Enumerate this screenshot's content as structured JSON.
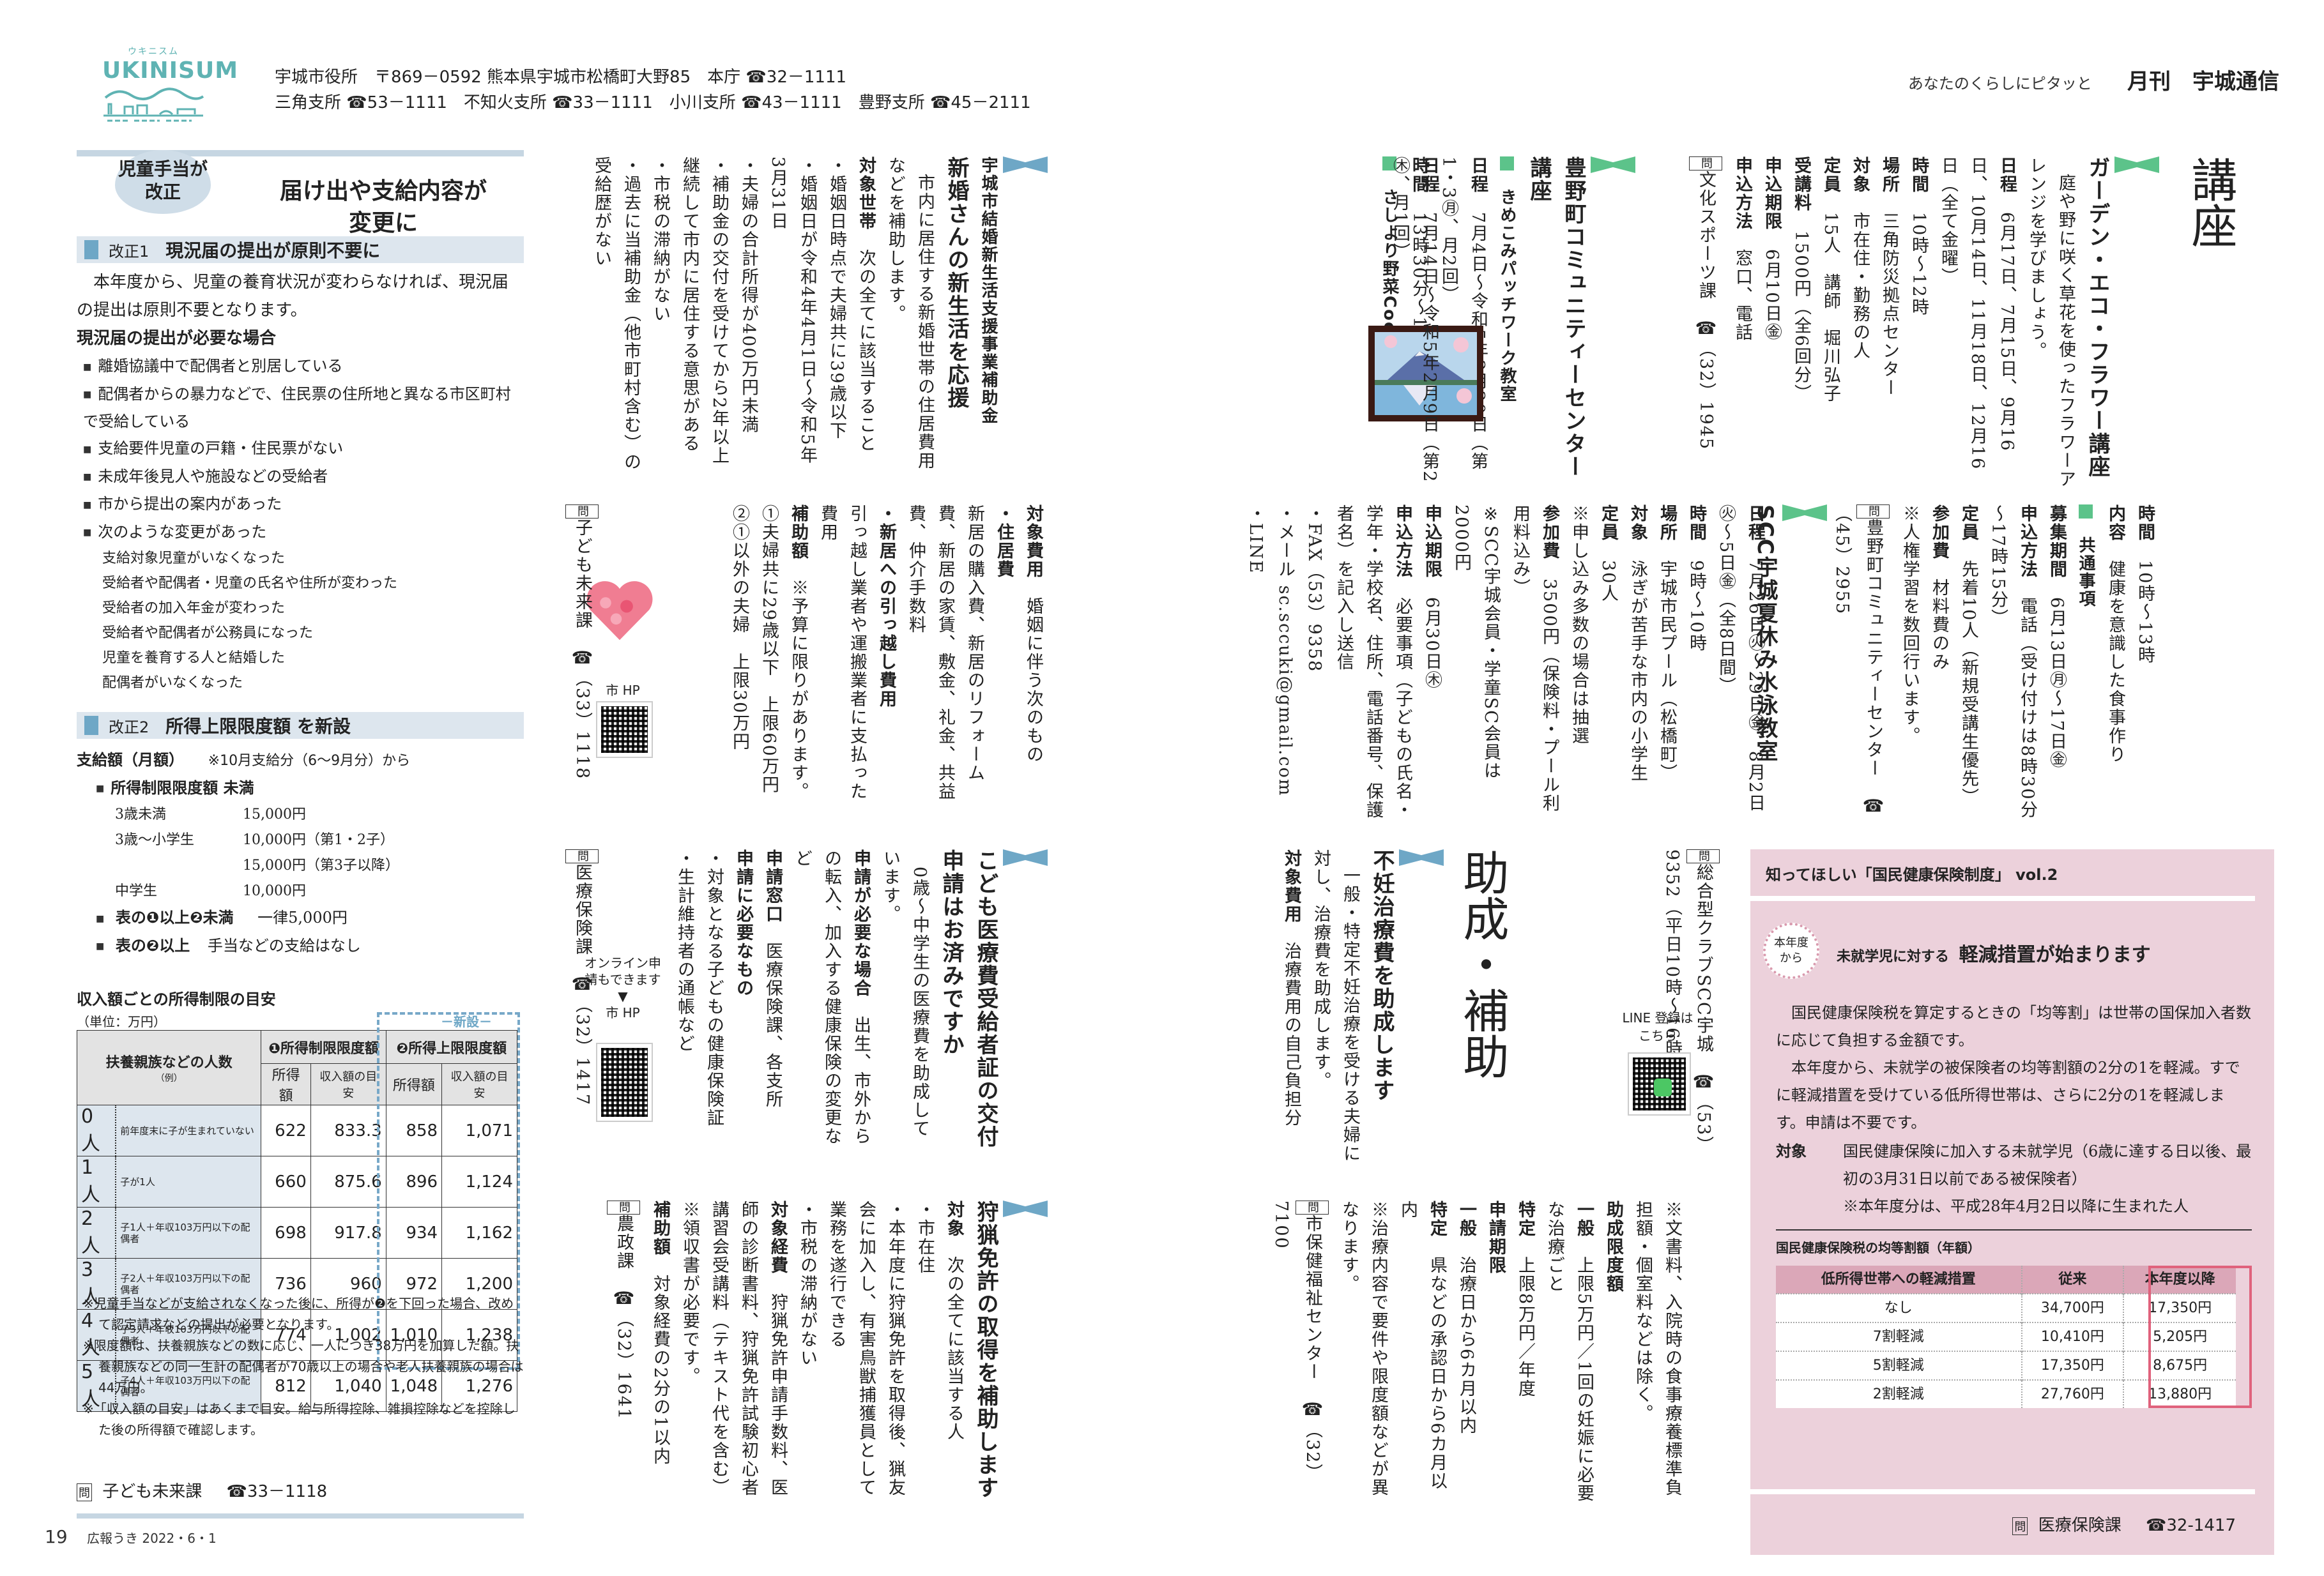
{
  "header": {
    "logo_kana": "ウキニスム",
    "logo_text": "UKINISUM",
    "line1": "宇城市役所　〒869－0592 熊本県宇城市松橋町大野85　本庁 ☎32－1111",
    "line2": "三角支所 ☎53－1111　不知火支所 ☎33－1111　小川支所 ☎43－1111　豊野支所 ☎45－2111",
    "tagline": "あなたのくらしにピタッと",
    "magazine_title": "月刊　宇城通信"
  },
  "child_allowance": {
    "bubble": [
      "児童手当が",
      "改正"
    ],
    "title": [
      "届け出や支給内容が",
      "変更に"
    ],
    "rev1": {
      "num": "改正1",
      "title": "現況届の提出が原則不要に"
    },
    "rev1_body": "本年度から、児童の養育状況が変わらなければ、現況届の提出は原則不要となります。",
    "rev1_required_heading": "現況届の提出が必要な場合",
    "rev1_items": [
      "離婚協議中で配偶者と別居している",
      "配偶者からの暴力などで、住民票の住所地と異なる市区町村で受給している",
      "支給要件児童の戸籍・住民票がない",
      "未成年後見人や施設などの受給者",
      "市から提出の案内があった",
      "次のような変更があった"
    ],
    "rev1_changes": [
      "支給対象児童がいなくなった",
      "受給者や配偶者・児童の氏名や住所が変わった",
      "受給者の加入年金が変わった",
      "受給者や配偶者が公務員になった",
      "児童を養育する人と結婚した",
      "配偶者がいなくなった"
    ],
    "rev2": {
      "num": "改正2",
      "title": "所得上限限度額 を新設"
    },
    "payment_label": "支給額（月額）",
    "payment_note": "※10月支給分（6～9月分）から",
    "under_limit_label": "所得制限限度額 未満",
    "amounts": [
      {
        "age": "3歳未満",
        "amount": "15,000円"
      },
      {
        "age": "3歳～小学生",
        "amount": "10,000円（第1・2子）"
      },
      {
        "age": "",
        "amount": "15,000円（第3子以降）"
      },
      {
        "age": "中学生",
        "amount": "10,000円"
      }
    ],
    "rule_1_to_2": {
      "label": "表の❶以上❷未満",
      "value": "一律5,000円"
    },
    "rule_2_over": {
      "label": "表の❷以上",
      "value": "手当などの支給はなし"
    },
    "table_title": "収入額ごとの所得制限の目安",
    "table_unit": "（単位：万円）",
    "table_new_label": "－新設－",
    "table_headers": {
      "dependents": "扶養親族などの人数",
      "dependents_note": "（例）",
      "limit1": "❶所得制限限度額",
      "limit2": "❷所得上限限度額",
      "income": "所得額",
      "revenue": "収入額の目安"
    },
    "table_rows": [
      {
        "n": "0人",
        "desc": "前年度末に子が生まれていない",
        "i1": "622",
        "r1": "833.3",
        "i2": "858",
        "r2": "1,071"
      },
      {
        "n": "1人",
        "desc": "子が1人",
        "i1": "660",
        "r1": "875.6",
        "i2": "896",
        "r2": "1,124"
      },
      {
        "n": "2人",
        "desc": "子1人＋年収103万円以下の配偶者",
        "i1": "698",
        "r1": "917.8",
        "i2": "934",
        "r2": "1,162"
      },
      {
        "n": "3人",
        "desc": "子2人＋年収103万円以下の配偶者",
        "i1": "736",
        "r1": "960",
        "i2": "972",
        "r2": "1,200"
      },
      {
        "n": "4人",
        "desc": "子3人＋年収103万円以下の配偶者",
        "i1": "774",
        "r1": "1,002",
        "i2": "1,010",
        "r2": "1,238"
      },
      {
        "n": "5人",
        "desc": "子4人＋年収103万円以下の配偶者",
        "i1": "812",
        "r1": "1,040",
        "i2": "1,048",
        "r2": "1,276"
      }
    ],
    "notes": [
      "※児童手当などが支給されなくなった後に、所得が❷を下回った場合、改めて認定請求などの提出が必要となります。",
      "※限度額は、扶養親族などの数に応じ、一人につき38万円を加算した額。扶養親族などの同一生計の配偶者が70歳以上の場合や老人扶養親族の場合は44万円。",
      "※「収入額の目安」はあくまで目安。給与所得控除、雑損控除などを控除した後の所得額で確認します。"
    ],
    "contact": {
      "dept": "子ども未来課",
      "tel": "☎33－1118"
    }
  },
  "newlywed": {
    "kicker": "宇城市結婚新生活支援事業補助金",
    "title": "新婚さんの新生活を応援",
    "lead": "市内に居住する新婚世帯の住居費用などを補助します。",
    "target_label": "対象世帯",
    "target_text": "次の全てに該当すること",
    "items": [
      "婚姻日時点で夫婦共に39歳以下",
      "婚姻日が令和4年4月1日～令和5年3月31日",
      "夫婦の合計所得が400万円未満",
      "補助金の交付を受けてから2年以上継続して市内に居住する意思がある",
      "市税の滞納がない",
      "過去に当補助金（他市町村含む）の受給歴がない"
    ],
    "cost_label": "対象費用",
    "cost_text": "婚姻に伴う次のもの",
    "housing_label": "・住居費",
    "housing_text": "新居の購入費、新居のリフォーム費、新居の家賃、敷金、礼金、共益費、仲介手数料",
    "moving_label": "・新居への引っ越し費用",
    "moving_text": "引っ越し業者や運搬業者に支払った費用",
    "amount_label": "補助額",
    "amount_note": "※予算に限りがあります。",
    "amount_items": [
      "①夫婦共に29歳以下　上限60万円",
      "②①以外の夫婦　上限30万円"
    ],
    "qr_label": "市 HP",
    "contact": {
      "dept": "子ども未来課",
      "tel": "☎（33）1118"
    }
  },
  "medical_card": {
    "title": "こども医療費受給者証の交付申請はお済みですか",
    "lead": "0歳～中学生の医療費を助成しています。",
    "when_label": "申請が必要な場合",
    "when_text": "出生、市外からの転入、加入する健康保険の変更など",
    "window_label": "申請窓口",
    "window_text": "医療保険課、各支所",
    "need_label": "申請に必要なもの",
    "need_items": [
      "対象となる子どもの健康保険証",
      "生計維持者の通帳など"
    ],
    "online_note": "オンライン申請もできます",
    "arrow": "▼",
    "qr_label": "市 HP",
    "contact": {
      "dept": "医療保険課",
      "tel": "☎（32）1417"
    }
  },
  "hunting": {
    "title": "狩猟免許の取得を補助します",
    "target_label": "対象",
    "target_text": "次の全てに該当する人",
    "target_items": [
      "市在住",
      "本年度に狩猟免許を取得後、猟友会に加入し、有害鳥獣捕獲員として業務を遂行できる",
      "市税の滞納がない"
    ],
    "cost_label": "対象経費",
    "cost_text": "狩猟免許申請手数料、医師の診断書料、狩猟免許試験初心者講習会受講料（テキスト代を含む）",
    "cost_note": "※領収書が必要です。",
    "amount_label": "補助額",
    "amount_text": "対象経費の2分の1以内",
    "contact": {
      "dept": "農政課",
      "tel": "☎（32）1641"
    }
  },
  "courses": {
    "section_title": "講座",
    "garden": {
      "title": "ガーデン・エコ・フラワー講座",
      "lead": "庭や野に咲く草花を使ったフラワーアレンジを学びましょう。",
      "rows": [
        {
          "k": "日程",
          "v": "6月17日、7月15日、9月16日、10月14日、11月18日、12月16日（全て金曜）"
        },
        {
          "k": "時間",
          "v": "10時～12時"
        },
        {
          "k": "場所",
          "v": "三角防災拠点センター"
        },
        {
          "k": "対象",
          "v": "市在住・勤務の人"
        },
        {
          "k": "定員",
          "v": "15人　講師　堀川弘子"
        },
        {
          "k": "受講料",
          "v": "1500円（全6回分）"
        },
        {
          "k": "申込期限",
          "v": "6月10日㊎"
        },
        {
          "k": "申込方法",
          "v": "窓口、電話"
        }
      ],
      "contact": {
        "dept": "文化スポーツ課",
        "tel": "☎（32）1945"
      }
    },
    "toyono": {
      "title": "豊野町コミュニティーセンター講座",
      "kimekomi": {
        "title": "きめこみパッチワーク教室",
        "rows": [
          {
            "k": "日程",
            "v": "7月4日～令和5年2月20日（第1・3㊊、月2回）"
          },
          {
            "k": "時間",
            "v": "13時30分～15時30分"
          }
        ]
      },
      "cooking": {
        "title": "さしより野菜Cooking",
        "ruby": "クッキング",
        "rows": [
          {
            "k": "日程",
            "v": "7月14日～令和5年2月9日（第2㊍、月1回）"
          },
          {
            "k": "時間",
            "v": "10時～13時"
          },
          {
            "k": "内容",
            "v": "健康を意識した食事作り"
          }
        ]
      },
      "common_label": "共通事項",
      "common_rows": [
        {
          "k": "募集期間",
          "v": "6月13日㊊～17日㊎"
        },
        {
          "k": "申込方法",
          "v": "電話（受け付けは8時30分～17時15分）"
        },
        {
          "k": "定員",
          "v": "先着10人（新規受講生優先）"
        },
        {
          "k": "参加費",
          "v": "材料費のみ"
        }
      ],
      "note": "※人権学習を数回行います。",
      "contact": {
        "dept": "豊野町コミュニティーセンター",
        "tel": "☎（45）2955"
      }
    },
    "scc": {
      "title": "SCC宇城夏休み水泳教室",
      "rows": [
        {
          "k": "日程",
          "v": "7月26日㊋～29日㊎、8月2日㊋～5日㊎（全8日間）"
        },
        {
          "k": "時間",
          "v": "9時～10時"
        },
        {
          "k": "場所",
          "v": "宇城市民プール（松橋町）"
        },
        {
          "k": "対象",
          "v": "泳ぎが苦手な市内の小学生"
        },
        {
          "k": "定員",
          "v": "30人"
        },
        {
          "k": "",
          "v": "※申し込み多数の場合は抽選"
        },
        {
          "k": "参加費",
          "v": "3500円（保険料・プール利用料込み）"
        },
        {
          "k": "",
          "v": "※SCC宇城会員・学童SC会員は2000円"
        },
        {
          "k": "申込期限",
          "v": "6月30日㊍"
        },
        {
          "k": "申込方法",
          "v": "必要事項（子どもの氏名・学年・学校名、住所、電話番号、保護者名）を記入し送信"
        },
        {
          "k": "",
          "v": "・FAX（53）9358"
        },
        {
          "k": "",
          "v": "・メール sc.sccuki@gmail.com"
        },
        {
          "k": "",
          "v": "・LINE"
        }
      ],
      "line_label": "LINE 登録はこちら",
      "contact": {
        "dept": "総合型クラブSCC宇城",
        "tel": "☎（53）9352（平日10時～16時）"
      }
    }
  },
  "subsidy": {
    "section_title": "助成・補助",
    "fertility": {
      "title": "不妊治療費を助成します",
      "lead": "一般・特定不妊治療を受ける夫婦に対し、治療費を助成します。",
      "cost_label": "対象費用",
      "cost_text": "治療費用の自己負担分",
      "cost_note": "※文書料、入院時の食事療養標準負担額・個室料などは除く。",
      "limit_label": "助成限度額",
      "limits": [
        {
          "k": "一般",
          "v": "上限5万円／1回の妊娠に必要な治療ごと"
        },
        {
          "k": "特定",
          "v": "上限8万円／年度"
        }
      ],
      "period_label": "申請期限",
      "periods": [
        {
          "k": "一般",
          "v": "治療日から6カ月以内"
        },
        {
          "k": "特定",
          "v": "県などの承認日から6カ月以内"
        }
      ],
      "note": "※治療内容で要件や限度額などが異なります。",
      "contact": {
        "dept": "市保健福祉センター",
        "tel": "☎（32）7100"
      }
    }
  },
  "nhi_box": {
    "header": "知ってほしい「国民健康保険制度」 vol.2",
    "badge": [
      "本年度",
      "から"
    ],
    "title_small": "未就学児に対する",
    "title_large": "軽減措置が始まります",
    "paragraphs": [
      "国民健康保険税を算定するときの「均等割」は世帯の国保加入者数に応じて負担する金額です。",
      "本年度から、未就学の被保険者の均等割額の2分の1を軽減。すでに軽減措置を受けている低所得世帯は、さらに2分の1を軽減します。申請は不要です。"
    ],
    "target_label": "対象",
    "target_text": "国民健康保険に加入する未就学児（6歳に達する日以後、最初の3月31日以前である被保険者）",
    "target_note": "※本年度分は、平成28年4月2日以降に生まれた人",
    "table_title": "国民健康保険税の均等割額（年額）",
    "table_headers": [
      "低所得世帯への軽減措置",
      "従来",
      "本年度以降"
    ],
    "table_rows": [
      [
        "なし",
        "34,700円",
        "17,350円"
      ],
      [
        "7割軽減",
        "10,410円",
        "5,205円"
      ],
      [
        "5割軽減",
        "17,350円",
        "8,675円"
      ],
      [
        "2割軽減",
        "27,760円",
        "13,880円"
      ]
    ],
    "contact": {
      "dept": "医療保険課",
      "tel": "☎32-1417"
    }
  },
  "footer": {
    "page": "19",
    "publication": "広報うき 2022・6・1"
  },
  "labels": {
    "inquiry": "問"
  },
  "colors": {
    "blue_accent": "#6ea7c6",
    "green_accent": "#5cc38a",
    "pink_box": "#ecd1db",
    "pink_highlight": "#e0627c",
    "logo_teal": "#5fb3b3"
  }
}
